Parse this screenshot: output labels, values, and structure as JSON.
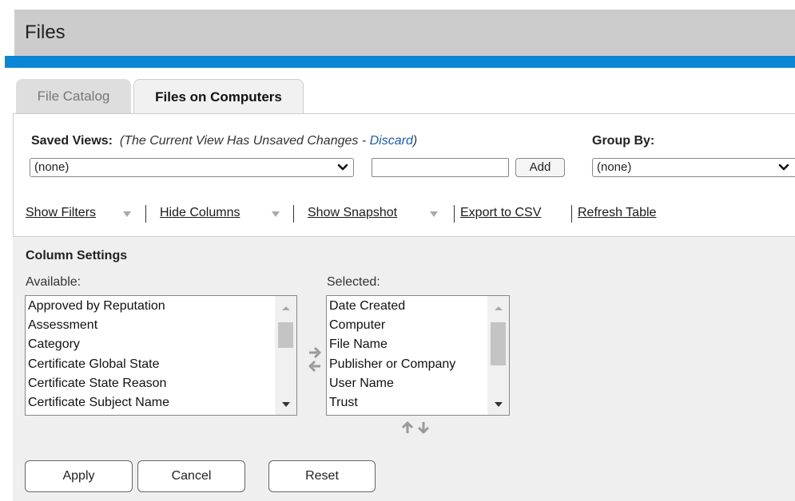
{
  "header": {
    "title": "Files"
  },
  "tabs": [
    {
      "label": "File Catalog",
      "active": false
    },
    {
      "label": "Files on Computers",
      "active": true
    }
  ],
  "saved_views": {
    "label": "Saved Views:",
    "notice_prefix": "(The Current View Has Unsaved Changes - ",
    "discard": "Discard",
    "notice_suffix": ")",
    "selected": "(none)",
    "name_value": "",
    "add_label": "Add"
  },
  "group_by": {
    "label": "Group By:",
    "selected": "(none)"
  },
  "toolbar": {
    "show_filters": "Show Filters",
    "hide_columns": "Hide Columns",
    "show_snapshot": "Show Snapshot",
    "export_csv": "Export to CSV",
    "refresh_table": "Refresh Table"
  },
  "column_settings": {
    "title": "Column Settings",
    "available_label": "Available:",
    "selected_label": "Selected:",
    "available": [
      "Approved by Reputation",
      "Assessment",
      "Category",
      "Certificate Global State",
      "Certificate State Reason",
      "Certificate Subject Name"
    ],
    "selected": [
      "Date Created",
      "Computer",
      "File Name",
      "Publisher or Company",
      "User Name",
      "Trust"
    ]
  },
  "buttons": {
    "apply": "Apply",
    "cancel": "Cancel",
    "reset": "Reset"
  },
  "colors": {
    "accent_bar": "#0b86d4",
    "header_bg": "#cccccc",
    "link": "#1d5aa8"
  },
  "icons": [
    "chevron-down-icon",
    "dropdown-triangle-icon",
    "arrow-right-icon",
    "arrow-left-icon",
    "arrow-up-icon",
    "arrow-down-icon"
  ]
}
